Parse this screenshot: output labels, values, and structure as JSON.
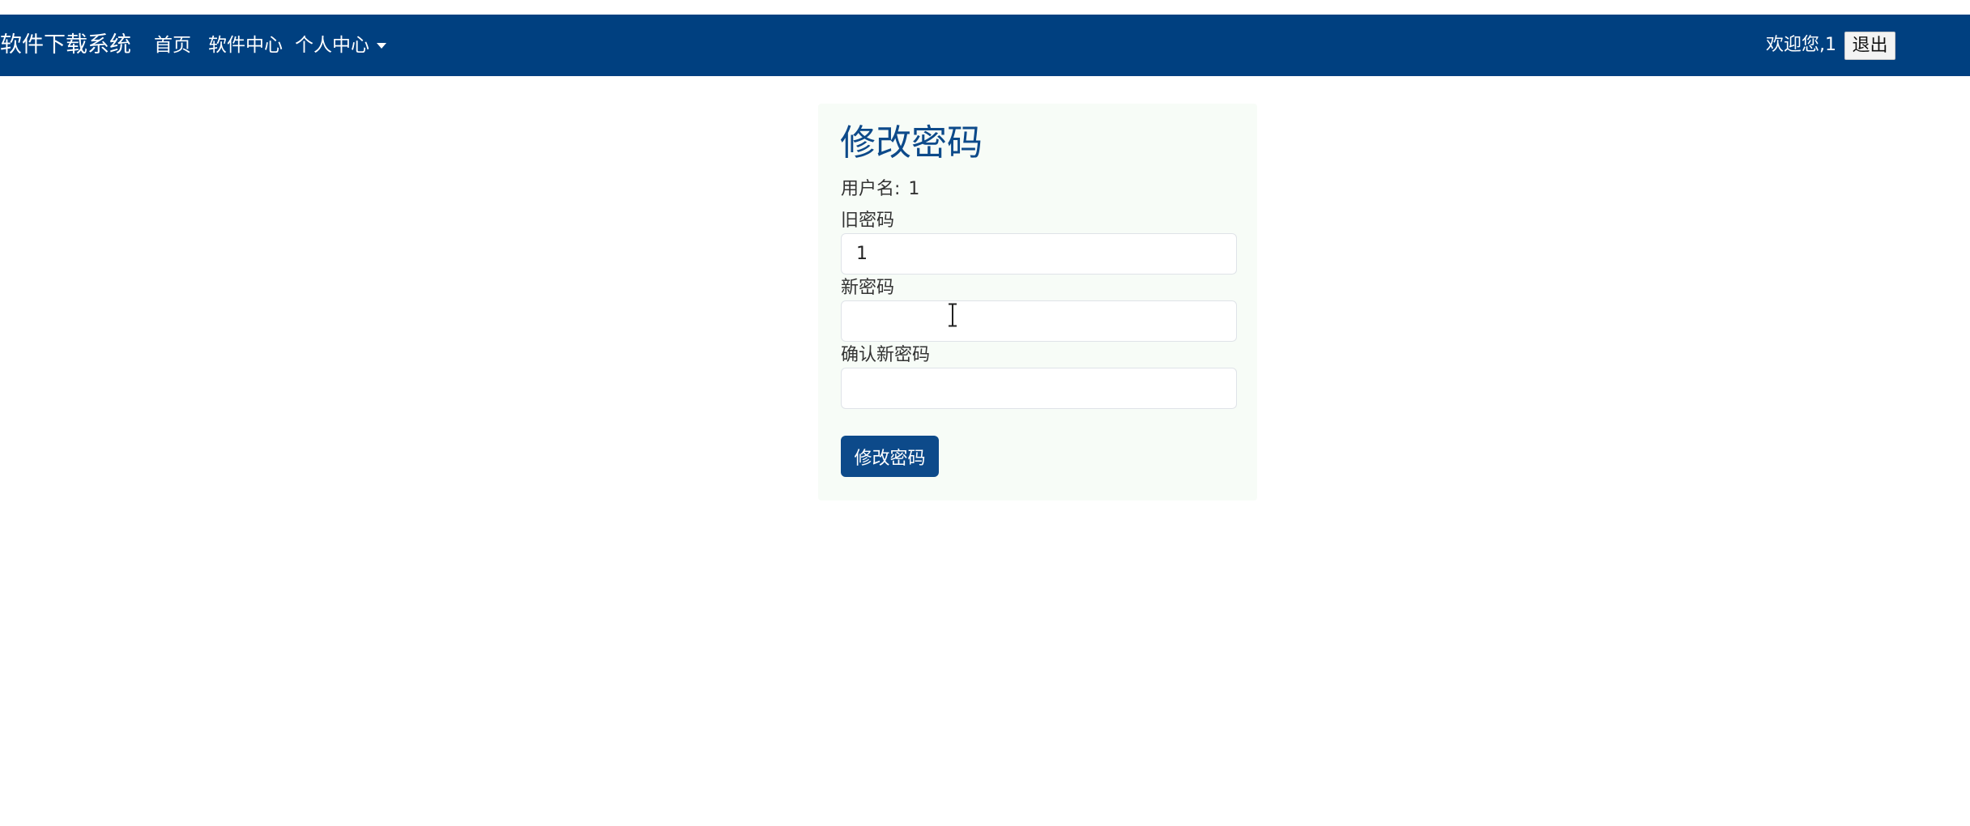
{
  "navbar": {
    "brand": "软件下载系统",
    "links": [
      {
        "label": "首页"
      },
      {
        "label": "软件中心"
      },
      {
        "label": "个人中心",
        "has_dropdown": true
      }
    ],
    "welcome_text": "欢迎您,1",
    "logout_label": "退出",
    "background_color": "#004080"
  },
  "form": {
    "title": "修改密码",
    "username_label": "用户名:",
    "username_value": "1",
    "old_password": {
      "label": "旧密码",
      "value": "1"
    },
    "new_password": {
      "label": "新密码",
      "value": ""
    },
    "confirm_password": {
      "label": "确认新密码",
      "value": ""
    },
    "submit_label": "修改密码",
    "accent_color": "#0d4a8a"
  }
}
